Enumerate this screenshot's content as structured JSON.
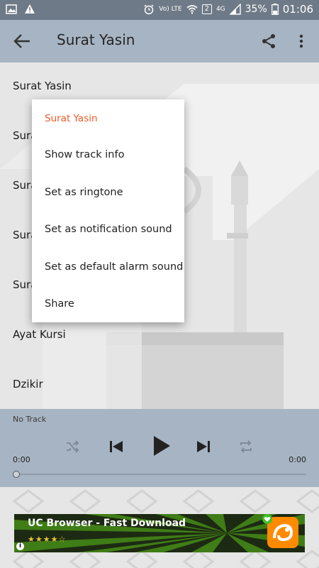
{
  "status_bar": {
    "left_icons": [
      "image-icon",
      "warning-icon"
    ],
    "lte_label": "Vo) LTE",
    "sim_badge": "2",
    "network_label": "4G",
    "battery": "35%",
    "time": "01:06"
  },
  "app_bar": {
    "title": "Surat Yasin",
    "back_icon": "arrow-back-icon",
    "share_icon": "share-icon",
    "more_icon": "more-vert-icon"
  },
  "list": {
    "items": [
      {
        "label": "Surat Yasin"
      },
      {
        "label": "Sura"
      },
      {
        "label": "Sura"
      },
      {
        "label": "Sura"
      },
      {
        "label": "Sura"
      },
      {
        "label": "Ayat Kursi"
      },
      {
        "label": "Dzikir"
      }
    ]
  },
  "context_menu": {
    "header": "Surat Yasin",
    "items": [
      {
        "label": "Show track info"
      },
      {
        "label": "Set as ringtone"
      },
      {
        "label": "Set as notification sound"
      },
      {
        "label": "Set as default alarm sound"
      },
      {
        "label": "Share"
      }
    ]
  },
  "player": {
    "track": "No Track",
    "elapsed": "0:00",
    "duration": "0:00",
    "progress": 0
  },
  "ad": {
    "title": "UC Browser - Fast Download",
    "stars": "★★★★☆",
    "info": "i",
    "accent_color": "#ff8a00"
  }
}
